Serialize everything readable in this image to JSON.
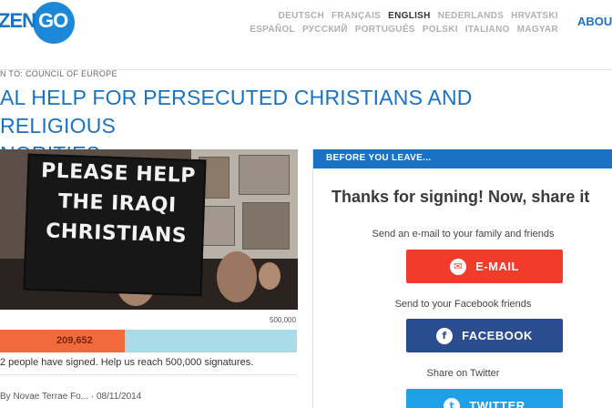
{
  "logo": {
    "zen": "ZEN",
    "go": "GO"
  },
  "languages": {
    "row1": [
      "DEUTSCH",
      "FRANÇAIS",
      "ENGLISH",
      "NEDERLANDS",
      "HRVATSKI"
    ],
    "row2": [
      "ESPAÑOL",
      "РУССКИЙ",
      "PORTUGUÊS",
      "POLSKI",
      "ITALIANO",
      "MAGYAR"
    ],
    "active": "ENGLISH"
  },
  "nav": {
    "about": "ABOU"
  },
  "petition": {
    "to": "N TO: COUNCIL OF EUROPE",
    "title_line1": "AL HELP FOR PERSECUTED CHRISTIANS AND RELIGIOUS",
    "title_line2": "NORITIES",
    "photo_sign": [
      "PLEASE HELP",
      "THE IRAQI",
      "CHRISTIANS"
    ],
    "goal": "500,000",
    "count": "209,652",
    "progress_fraction": 0.419,
    "signed_text": "2 people have signed. Help us reach 500,000 signatures.",
    "author": "By Novae Terrae Fo... · 08/11/2014"
  },
  "share_panel": {
    "header": "BEFORE YOU LEAVE...",
    "thanks": "Thanks for signing! Now, share it",
    "email_caption": "Send an e-mail to your family and friends",
    "email_label": "E-MAIL",
    "facebook_caption": "Send to your Facebook friends",
    "facebook_label": "FACEBOOK",
    "twitter_caption": "Share on Twitter",
    "twitter_label": "TWITTER"
  },
  "colors": {
    "brand_blue": "#1a72c4",
    "email_red": "#f23c2b",
    "facebook_blue": "#2b4c8f",
    "twitter_blue": "#1da0e6",
    "progress_fill": "#f06a3b",
    "progress_track": "#a9dbe8"
  }
}
